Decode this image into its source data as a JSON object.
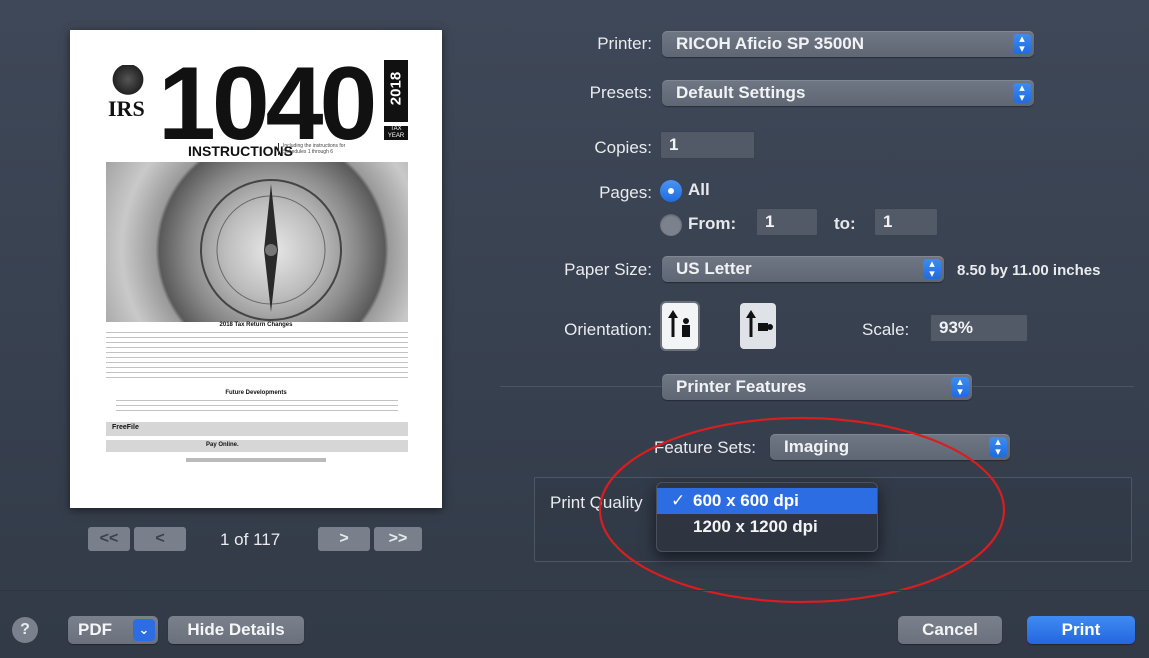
{
  "preview": {
    "irs_label": "IRS",
    "form_number": "1040",
    "year": "2018",
    "tax_year_label": "TAX YEAR",
    "instructions_label": "INSTRUCTIONS",
    "instructions_note": "Including the instructions for Schedules 1 through 6",
    "changes_heading": "2018 Tax Return Changes",
    "future_heading": "Future Developments",
    "freefile_label": "FreeFile",
    "pay_online_label": "Pay Online."
  },
  "pager": {
    "first": "<<",
    "prev": "<",
    "page_text": "1 of 117",
    "next": ">",
    "last": ">>"
  },
  "printer": {
    "label": "Printer:",
    "value": "RICOH Aficio SP 3500N"
  },
  "presets": {
    "label": "Presets:",
    "value": "Default Settings"
  },
  "copies": {
    "label": "Copies:",
    "value": "1"
  },
  "pages": {
    "label": "Pages:",
    "all_label": "All",
    "from_label": "From:",
    "from_value": "1",
    "to_label": "to:",
    "to_value": "1"
  },
  "paper_size": {
    "label": "Paper Size:",
    "value": "US Letter",
    "dims": "8.50 by 11.00 inches"
  },
  "orientation": {
    "label": "Orientation:"
  },
  "scale": {
    "label": "Scale:",
    "value": "93%"
  },
  "section_popup": {
    "value": "Printer Features"
  },
  "feature_sets": {
    "label": "Feature Sets:",
    "value": "Imaging"
  },
  "print_quality": {
    "label": "Print Quality",
    "options": [
      "600 x 600 dpi",
      "1200 x 1200 dpi"
    ],
    "selected_index": 0
  },
  "footer": {
    "help": "?",
    "pdf": "PDF",
    "hide_details": "Hide Details",
    "cancel": "Cancel",
    "print": "Print"
  },
  "colors": {
    "accent": "#2d6de4",
    "annotation": "#d81e1e"
  }
}
